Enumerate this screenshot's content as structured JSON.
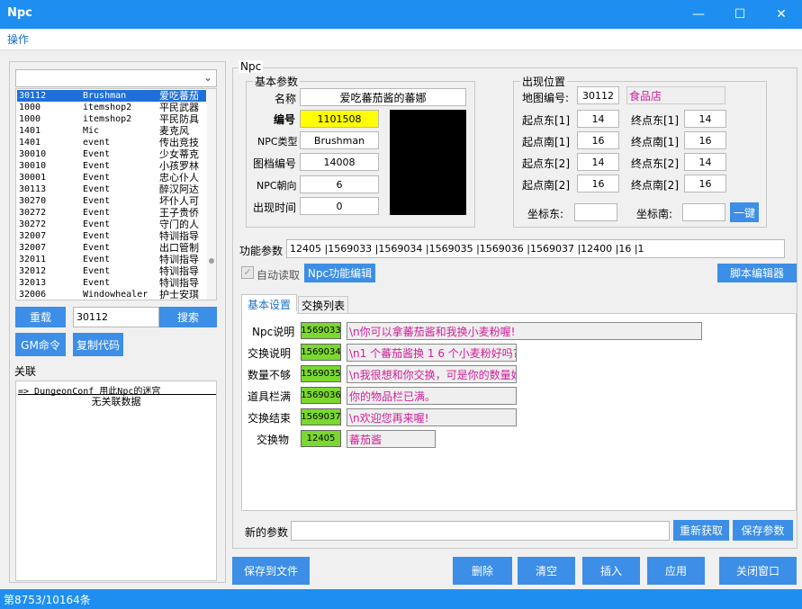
{
  "window": {
    "title": "Npc",
    "minimize": "—",
    "maximize": "☐",
    "close": "✕"
  },
  "menu": {
    "item": "操作"
  },
  "left": {
    "list_rows": [
      [
        "30112",
        "Brushman",
        "爱吃蕃茄"
      ],
      [
        "1000",
        "itemshop2",
        "平民武器"
      ],
      [
        "1000",
        "itemshop2",
        "平民防具"
      ],
      [
        "1401",
        "Mic",
        "麦克风"
      ],
      [
        "1401",
        "event",
        "传出竞技"
      ],
      [
        "30010",
        "Event",
        "少女蒂克"
      ],
      [
        "30010",
        "Event",
        "小孩罗林"
      ],
      [
        "30001",
        "Event",
        "忠心仆人"
      ],
      [
        "30113",
        "Event",
        "醉汉阿达"
      ],
      [
        "30270",
        "Event",
        "坏仆人可"
      ],
      [
        "30272",
        "Event",
        "王子贵侨"
      ],
      [
        "30272",
        "Event",
        "守门的人"
      ],
      [
        "32007",
        "Event",
        "特训指导"
      ],
      [
        "32007",
        "Event",
        "出口管制"
      ],
      [
        "32011",
        "Event",
        "特训指导"
      ],
      [
        "32012",
        "Event",
        "特训指导"
      ],
      [
        "32013",
        "Event",
        "特训指导"
      ],
      [
        "32006",
        "Windowhealer",
        "护士安琪"
      ]
    ],
    "reload_button": "重载",
    "search_value": "30112",
    "search_button": "搜索",
    "gm_button": "GM命令",
    "copy_button": "复制代码",
    "relation_label": "关联",
    "relation_line1": "=> DungeonConf 用此Npc的迷宫",
    "relation_line2": "无关联数据"
  },
  "npc": {
    "group_title": "Npc",
    "basic_title": "基本参数",
    "name_label": "名称",
    "name_value": "爱吃蕃茄酱的蕃娜",
    "id_label": "编号",
    "id_value": "1101508",
    "type_label": "NPC类型",
    "type_value": "Brushman",
    "file_label": "图档编号",
    "file_value": "14008",
    "dir_label": "NPC朝向",
    "dir_value": "6",
    "time_label": "出现时间",
    "time_value": "0",
    "pos_title": "出现位置",
    "map_label": "地图编号:",
    "map_value": "30112",
    "map_name": "食品店",
    "e1_label": "起点东[1]",
    "e1_value": "14",
    "e1e_label": "终点东[1]",
    "e1e_value": "14",
    "s1_label": "起点南[1]",
    "s1_value": "16",
    "s1e_label": "终点南[1]",
    "s1e_value": "16",
    "e2_label": "起点东[2]",
    "e2_value": "14",
    "e2e_label": "终点东[2]",
    "e2e_value": "14",
    "s2_label": "起点南[2]",
    "s2_value": "16",
    "s2e_label": "终点南[2]",
    "s2e_value": "16",
    "cx_label": "坐标东:",
    "cy_label": "坐标南:",
    "one_key": "一键",
    "func_label": "功能参数",
    "func_value": "12405 |1569033 |1569034 |1569035 |1569036 |1569037 |12400 |16 |1",
    "auto_read": "自动读取",
    "func_edit": "Npc功能编辑",
    "script_edit": "脚本编辑器"
  },
  "tabs": {
    "basic": "基本设置",
    "exchange": "交换列表"
  },
  "settings": [
    {
      "label": "Npc说明",
      "code": "1569033",
      "text": "\\n你可以拿蕃茄酱和我换小麦粉喔!"
    },
    {
      "label": "交换说明",
      "code": "1569034",
      "text": "\\n1 个蕃茄酱换 1 6 个小麦粉好吗?"
    },
    {
      "label": "数量不够",
      "code": "1569035",
      "text": "\\n我很想和你交换，可是你的数量好"
    },
    {
      "label": "道具栏满",
      "code": "1569036",
      "text": "你的物品栏已满。"
    },
    {
      "label": "交换结束",
      "code": "1569037",
      "text": "\\n欢迎您再来喔!"
    },
    {
      "label": "交换物",
      "code": "12405",
      "text": "蕃茄酱"
    }
  ],
  "new_param": {
    "label": "新的参数",
    "refetch": "重新获取",
    "save": "保存参数"
  },
  "bottom": {
    "save_file": "保存到文件",
    "delete": "删除",
    "clear": "清空",
    "insert": "插入",
    "apply": "应用",
    "close": "关闭窗口"
  },
  "status": "第8753/10164条"
}
